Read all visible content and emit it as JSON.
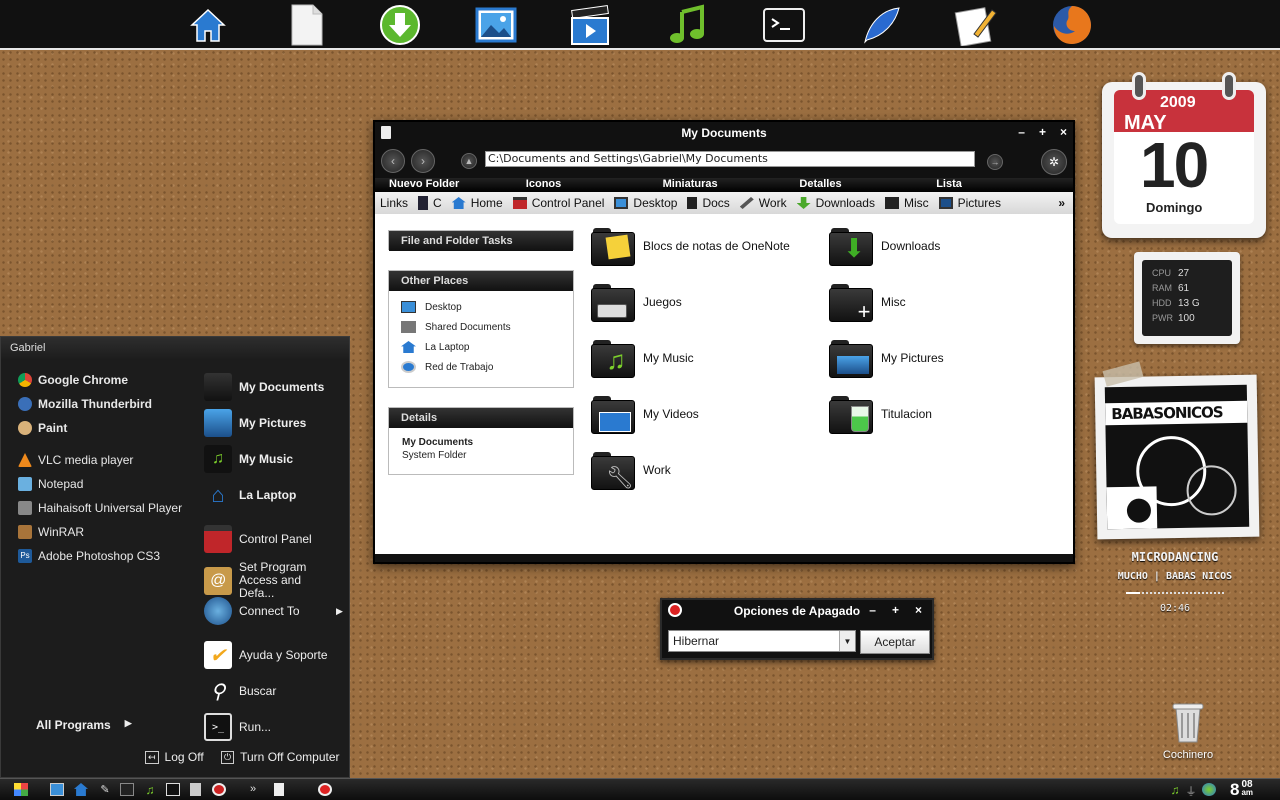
{
  "dock": {
    "icons": [
      "home-icon",
      "document-icon",
      "download-icon",
      "pictures-icon",
      "video-icon",
      "music-icon",
      "terminal-icon",
      "feather-icon",
      "notepad-icon",
      "firefox-icon"
    ]
  },
  "explorer": {
    "title": "My Documents",
    "address": "C:\\Documents and Settings\\Gabriel\\My Documents",
    "views": [
      "Nuevo Folder",
      "Iconos",
      "Miniaturas",
      "Detalles",
      "Lista"
    ],
    "links_label": "Links",
    "links": [
      "C",
      "Home",
      "Control Panel",
      "Desktop",
      "Docs",
      "Work",
      "Downloads",
      "Misc",
      "Pictures"
    ],
    "tasks": {
      "file_tasks": "File and Folder Tasks",
      "other_places": "Other Places",
      "places": [
        "Desktop",
        "Shared Documents",
        "La Laptop",
        "Red de Trabajo"
      ],
      "details": "Details",
      "details_name": "My Documents",
      "details_type": "System Folder"
    },
    "folders": [
      "Blocs de notas de OneNote",
      "Downloads",
      "Juegos",
      "Misc",
      "My Music",
      "My Pictures",
      "My Videos",
      "Titulacion",
      "Work"
    ]
  },
  "start_menu": {
    "user": "Gabriel",
    "pinned": [
      "Google Chrome",
      "Mozilla Thunderbird",
      "Paint"
    ],
    "recent": [
      "VLC media player",
      "Notepad",
      "Haihaisoft Universal Player",
      "WinRAR",
      "Adobe Photoshop CS3"
    ],
    "right": [
      "My Documents",
      "My Pictures",
      "My Music",
      "La Laptop",
      "Control Panel",
      "Set Program Access and Defa...",
      "Connect To",
      "Ayuda y Soporte",
      "Buscar",
      "Run..."
    ],
    "all_programs": "All Programs",
    "log_off": "Log Off",
    "turn_off": "Turn Off Computer"
  },
  "shutdown": {
    "title": "Opciones de Apagado",
    "selected": "Hibernar",
    "accept": "Aceptar"
  },
  "calendar": {
    "year": "2009",
    "month": "MAY",
    "day": "10",
    "weekday": "Domingo"
  },
  "stats": {
    "cpu_label": "CPU",
    "cpu": "27",
    "ram_label": "RAM",
    "ram": "61",
    "hdd_label": "HDD",
    "hdd": "13 G",
    "pwr_label": "PWR",
    "pwr": "100"
  },
  "media": {
    "album_art": "BABASONICOS",
    "track": "MICRODANCING",
    "artist_line": "MUCHO | BABAS NICOS",
    "time": "02:46"
  },
  "desktop": {
    "trash": "Cochinero"
  },
  "clock": {
    "hour": "8",
    "min": "08",
    "ampm": "am"
  },
  "colors": {
    "accent": "#1e78c8",
    "calendar_red": "#c8323c",
    "cork": "#9c6f41"
  }
}
